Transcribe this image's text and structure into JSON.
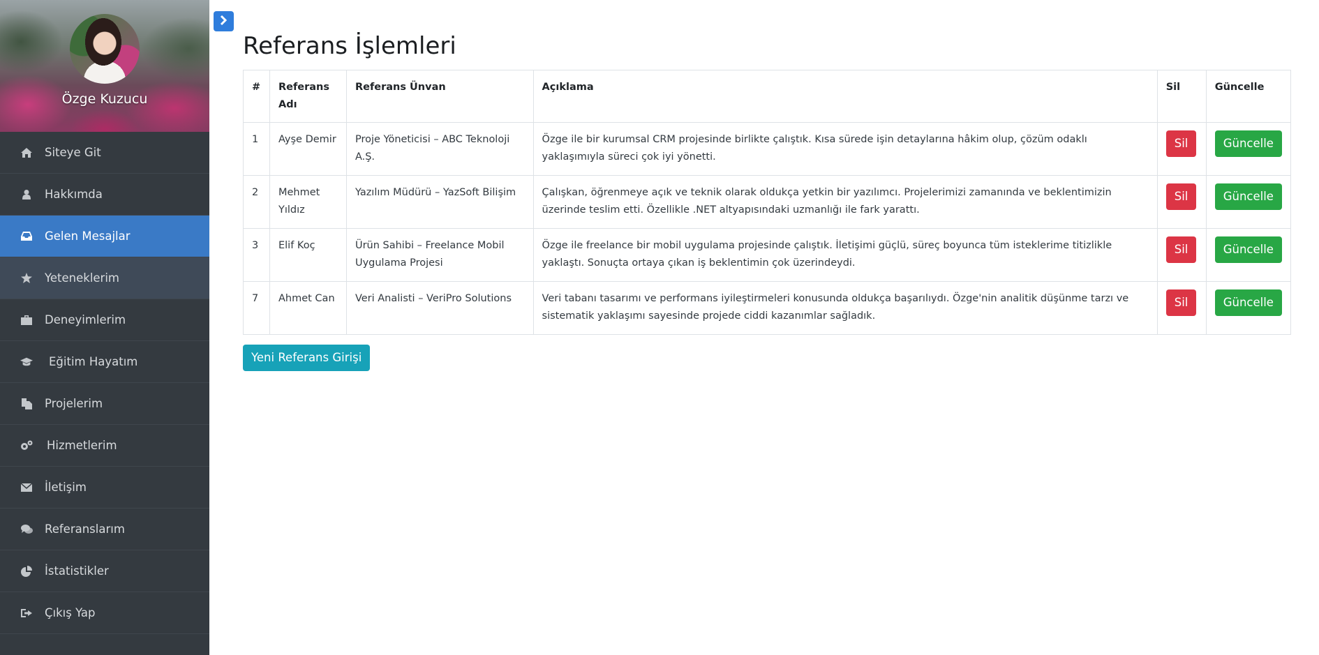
{
  "sidebar": {
    "profile_name": "Özge Kuzucu",
    "items": [
      {
        "label": "Siteye Git",
        "icon": "home-icon"
      },
      {
        "label": "Hakkımda",
        "icon": "user-icon"
      },
      {
        "label": "Gelen Mesajlar",
        "icon": "inbox-icon"
      },
      {
        "label": "Yeteneklerim",
        "icon": "star-icon"
      },
      {
        "label": "Deneyimlerim",
        "icon": "briefcase-icon"
      },
      {
        "label": "Eğitim Hayatım",
        "icon": "graduation-cap-icon"
      },
      {
        "label": "Projelerim",
        "icon": "files-icon"
      },
      {
        "label": "Hizmetlerim",
        "icon": "gears-icon"
      },
      {
        "label": "İletişim",
        "icon": "envelope-icon"
      },
      {
        "label": "Referanslarım",
        "icon": "comments-icon"
      },
      {
        "label": "İstatistikler",
        "icon": "pie-chart-icon"
      },
      {
        "label": "Çıkış Yap",
        "icon": "sign-out-icon"
      }
    ]
  },
  "page": {
    "title": "Referans İşlemleri",
    "new_button": "Yeni Referans Girişi"
  },
  "colors": {
    "sidebar_bg": "#343a40",
    "active_item": "#3a7ac6",
    "delete": "#dc3545",
    "update": "#28a745",
    "new": "#17a2b8",
    "toggle": "#2f7ddc"
  },
  "table": {
    "headers": [
      "#",
      "Referans Adı",
      "Referans Ünvan",
      "Açıklama",
      "Sil",
      "Güncelle"
    ],
    "rows": [
      {
        "id": "1",
        "name": "Ayşe Demir",
        "title": "Proje Yöneticisi – ABC Teknoloji A.Ş.",
        "desc": "Özge ile bir kurumsal CRM projesinde birlikte çalıştık. Kısa sürede işin detaylarına hâkim olup, çözüm odaklı yaklaşımıyla süreci çok iyi yönetti.",
        "del": "Sil",
        "upd": "Güncelle"
      },
      {
        "id": "2",
        "name": "Mehmet Yıldız",
        "title": "Yazılım Müdürü – YazSoft Bilişim",
        "desc": "Çalışkan, öğrenmeye açık ve teknik olarak oldukça yetkin bir yazılımcı. Projelerimizi zamanında ve beklentimizin üzerinde teslim etti. Özellikle .NET altyapısındaki uzmanlığı ile fark yarattı.",
        "del": "Sil",
        "upd": "Güncelle"
      },
      {
        "id": "3",
        "name": "Elif Koç",
        "title": "Ürün Sahibi – Freelance Mobil Uygulama Projesi",
        "desc": "Özge ile freelance bir mobil uygulama projesinde çalıştık. İletişimi güçlü, süreç boyunca tüm isteklerime titizlikle yaklaştı. Sonuçta ortaya çıkan iş beklentimin çok üzerindeydi.",
        "del": "Sil",
        "upd": "Güncelle"
      },
      {
        "id": "7",
        "name": "Ahmet Can",
        "title": "Veri Analisti – VeriPro Solutions",
        "desc": "Veri tabanı tasarımı ve performans iyileştirmeleri konusunda oldukça başarılıydı. Özge'nin analitik düşünme tarzı ve sistematik yaklaşımı sayesinde projede ciddi kazanımlar sağladık.",
        "del": "Sil",
        "upd": "Güncelle"
      }
    ]
  }
}
